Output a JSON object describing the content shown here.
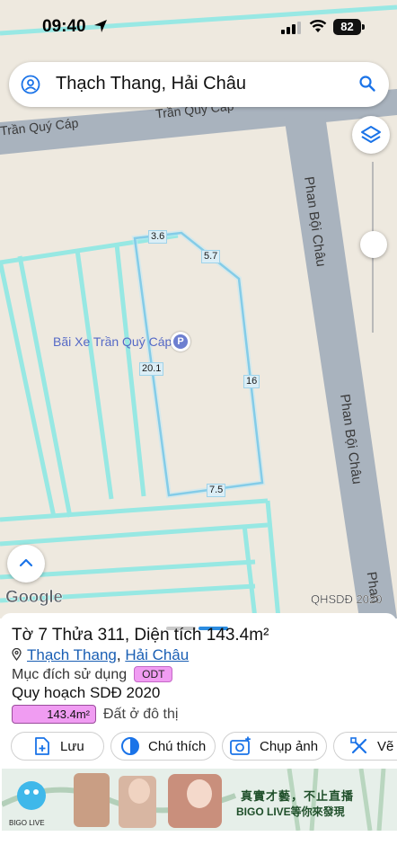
{
  "status_bar": {
    "time": "09:40",
    "battery": "82"
  },
  "search": {
    "query": "Thạch Thang, Hải Châu"
  },
  "map": {
    "streets": {
      "tran_quy_cap_1": "Trần Quý Cáp",
      "tran_quy_cap_2": "Trần Quý Cáp",
      "phan_boi_chau_1": "Phan Bội Châu",
      "phan_boi_chau_2": "Phan Bội Châu",
      "phan_boi_chau_3": "Phan"
    },
    "poi": {
      "name": "Bãi Xe Trần Quý Cáp",
      "badge": "P"
    },
    "parcel_edges": [
      "3.6",
      "5.7",
      "20.1",
      "16",
      "7.5"
    ],
    "attribution": "Google",
    "layer_label": "QHSDĐ 2020"
  },
  "sheet": {
    "title": "Tờ 7 Thửa 311, Diện tích 143.4m²",
    "ward": "Thạch Thang",
    "separator": ",",
    "district": "Hải Châu",
    "purpose_label": "Mục đích sử dụng",
    "purpose_code": "ODT",
    "plan_label": "Quy hoạch SDĐ 2020",
    "plan_area": "143.4m²",
    "plan_type": "Đất ở đô thị",
    "actions": {
      "save": "Lưu",
      "legend": "Chú thích",
      "screenshot": "Chụp ảnh",
      "draw": "Vẽ"
    }
  },
  "ad": {
    "brand": "BIGO LIVE",
    "line1": "真實才藝，不止直播",
    "line2": "BIGO LIVE等你來發現"
  },
  "colors": {
    "map_bg": "#eee9df",
    "road": "#a9b3be",
    "parcel_line": "#8ee8e4",
    "selected_parcel": "#4aaed8",
    "link": "#1a5fb4",
    "accent_blue": "#1a73e8",
    "odt_pink": "#f09cf2"
  }
}
